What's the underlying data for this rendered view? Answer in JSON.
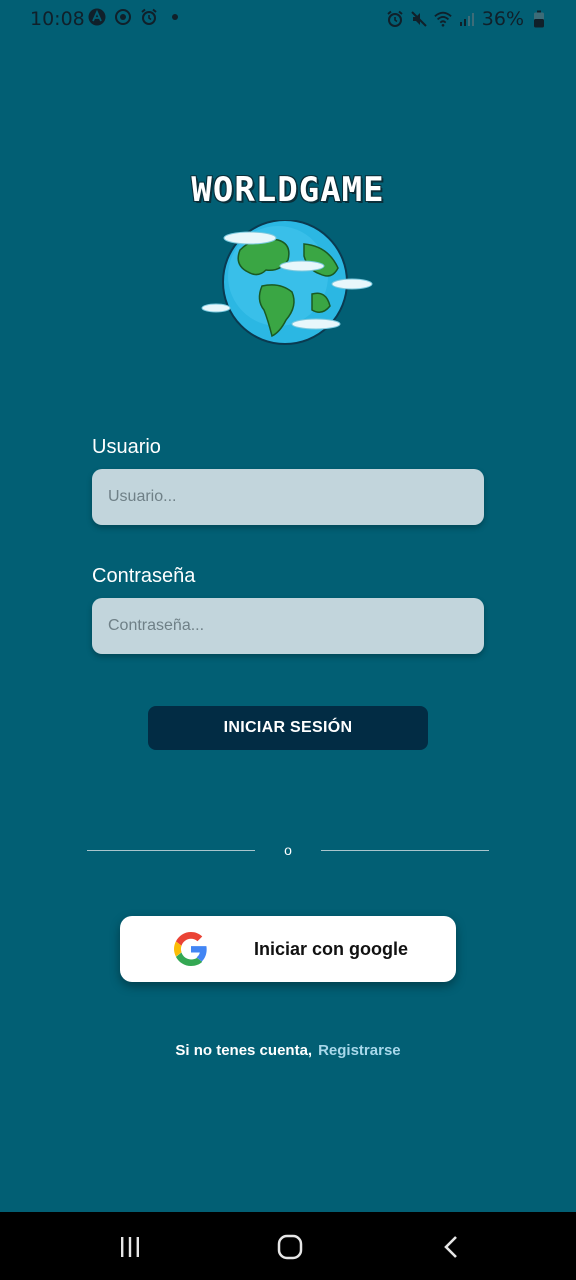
{
  "status_bar": {
    "time": "10:08",
    "battery_percent": "36%",
    "left_icons": [
      "app-a-icon",
      "sync-icon",
      "alarm-icon",
      "dot-icon"
    ],
    "right_icons": [
      "alarm-icon",
      "mute-icon",
      "wifi-icon",
      "signal-icon",
      "battery-icon"
    ]
  },
  "app": {
    "title": "WORLDGAME",
    "logo_icon": "globe-icon"
  },
  "form": {
    "user_label": "Usuario",
    "user_placeholder": "Usuario...",
    "password_label": "Contraseña",
    "password_placeholder": "Contraseña...",
    "login_button": "INICIAR SESIÓN"
  },
  "divider": {
    "text": "o"
  },
  "google": {
    "label": "Iniciar con google",
    "icon": "google-icon"
  },
  "signup": {
    "question": "Si no tenes cuenta,",
    "link": "Registrarse"
  },
  "nav_bar": {
    "buttons": [
      "recent-apps-icon",
      "home-icon",
      "back-icon"
    ]
  },
  "colors": {
    "background": "#025f74",
    "input_bg": "#c2d5dc",
    "login_button_bg": "#022c44",
    "link": "#a8d8ea"
  }
}
